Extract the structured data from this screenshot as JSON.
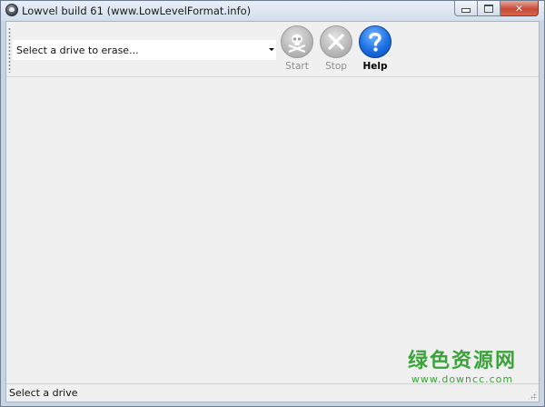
{
  "window": {
    "title": "Lowvel build 61 (www.LowLevelFormat.info)"
  },
  "toolbar": {
    "drive_select_value": "Select a drive to erase...",
    "start_label": "Start",
    "stop_label": "Stop",
    "help_label": "Help",
    "start_icon": "skull-crossbones-icon",
    "stop_icon": "x-icon",
    "help_icon": "question-mark-icon"
  },
  "statusbar": {
    "text": "Select a drive"
  },
  "watermark": {
    "cn_text": "绿色资源网",
    "url": "www.downcc.com"
  },
  "colors": {
    "help_blue": "#1b6fe2",
    "disabled_gray": "#b7b7b7",
    "close_red": "#c74a36",
    "watermark_green": "#3aa33a"
  }
}
